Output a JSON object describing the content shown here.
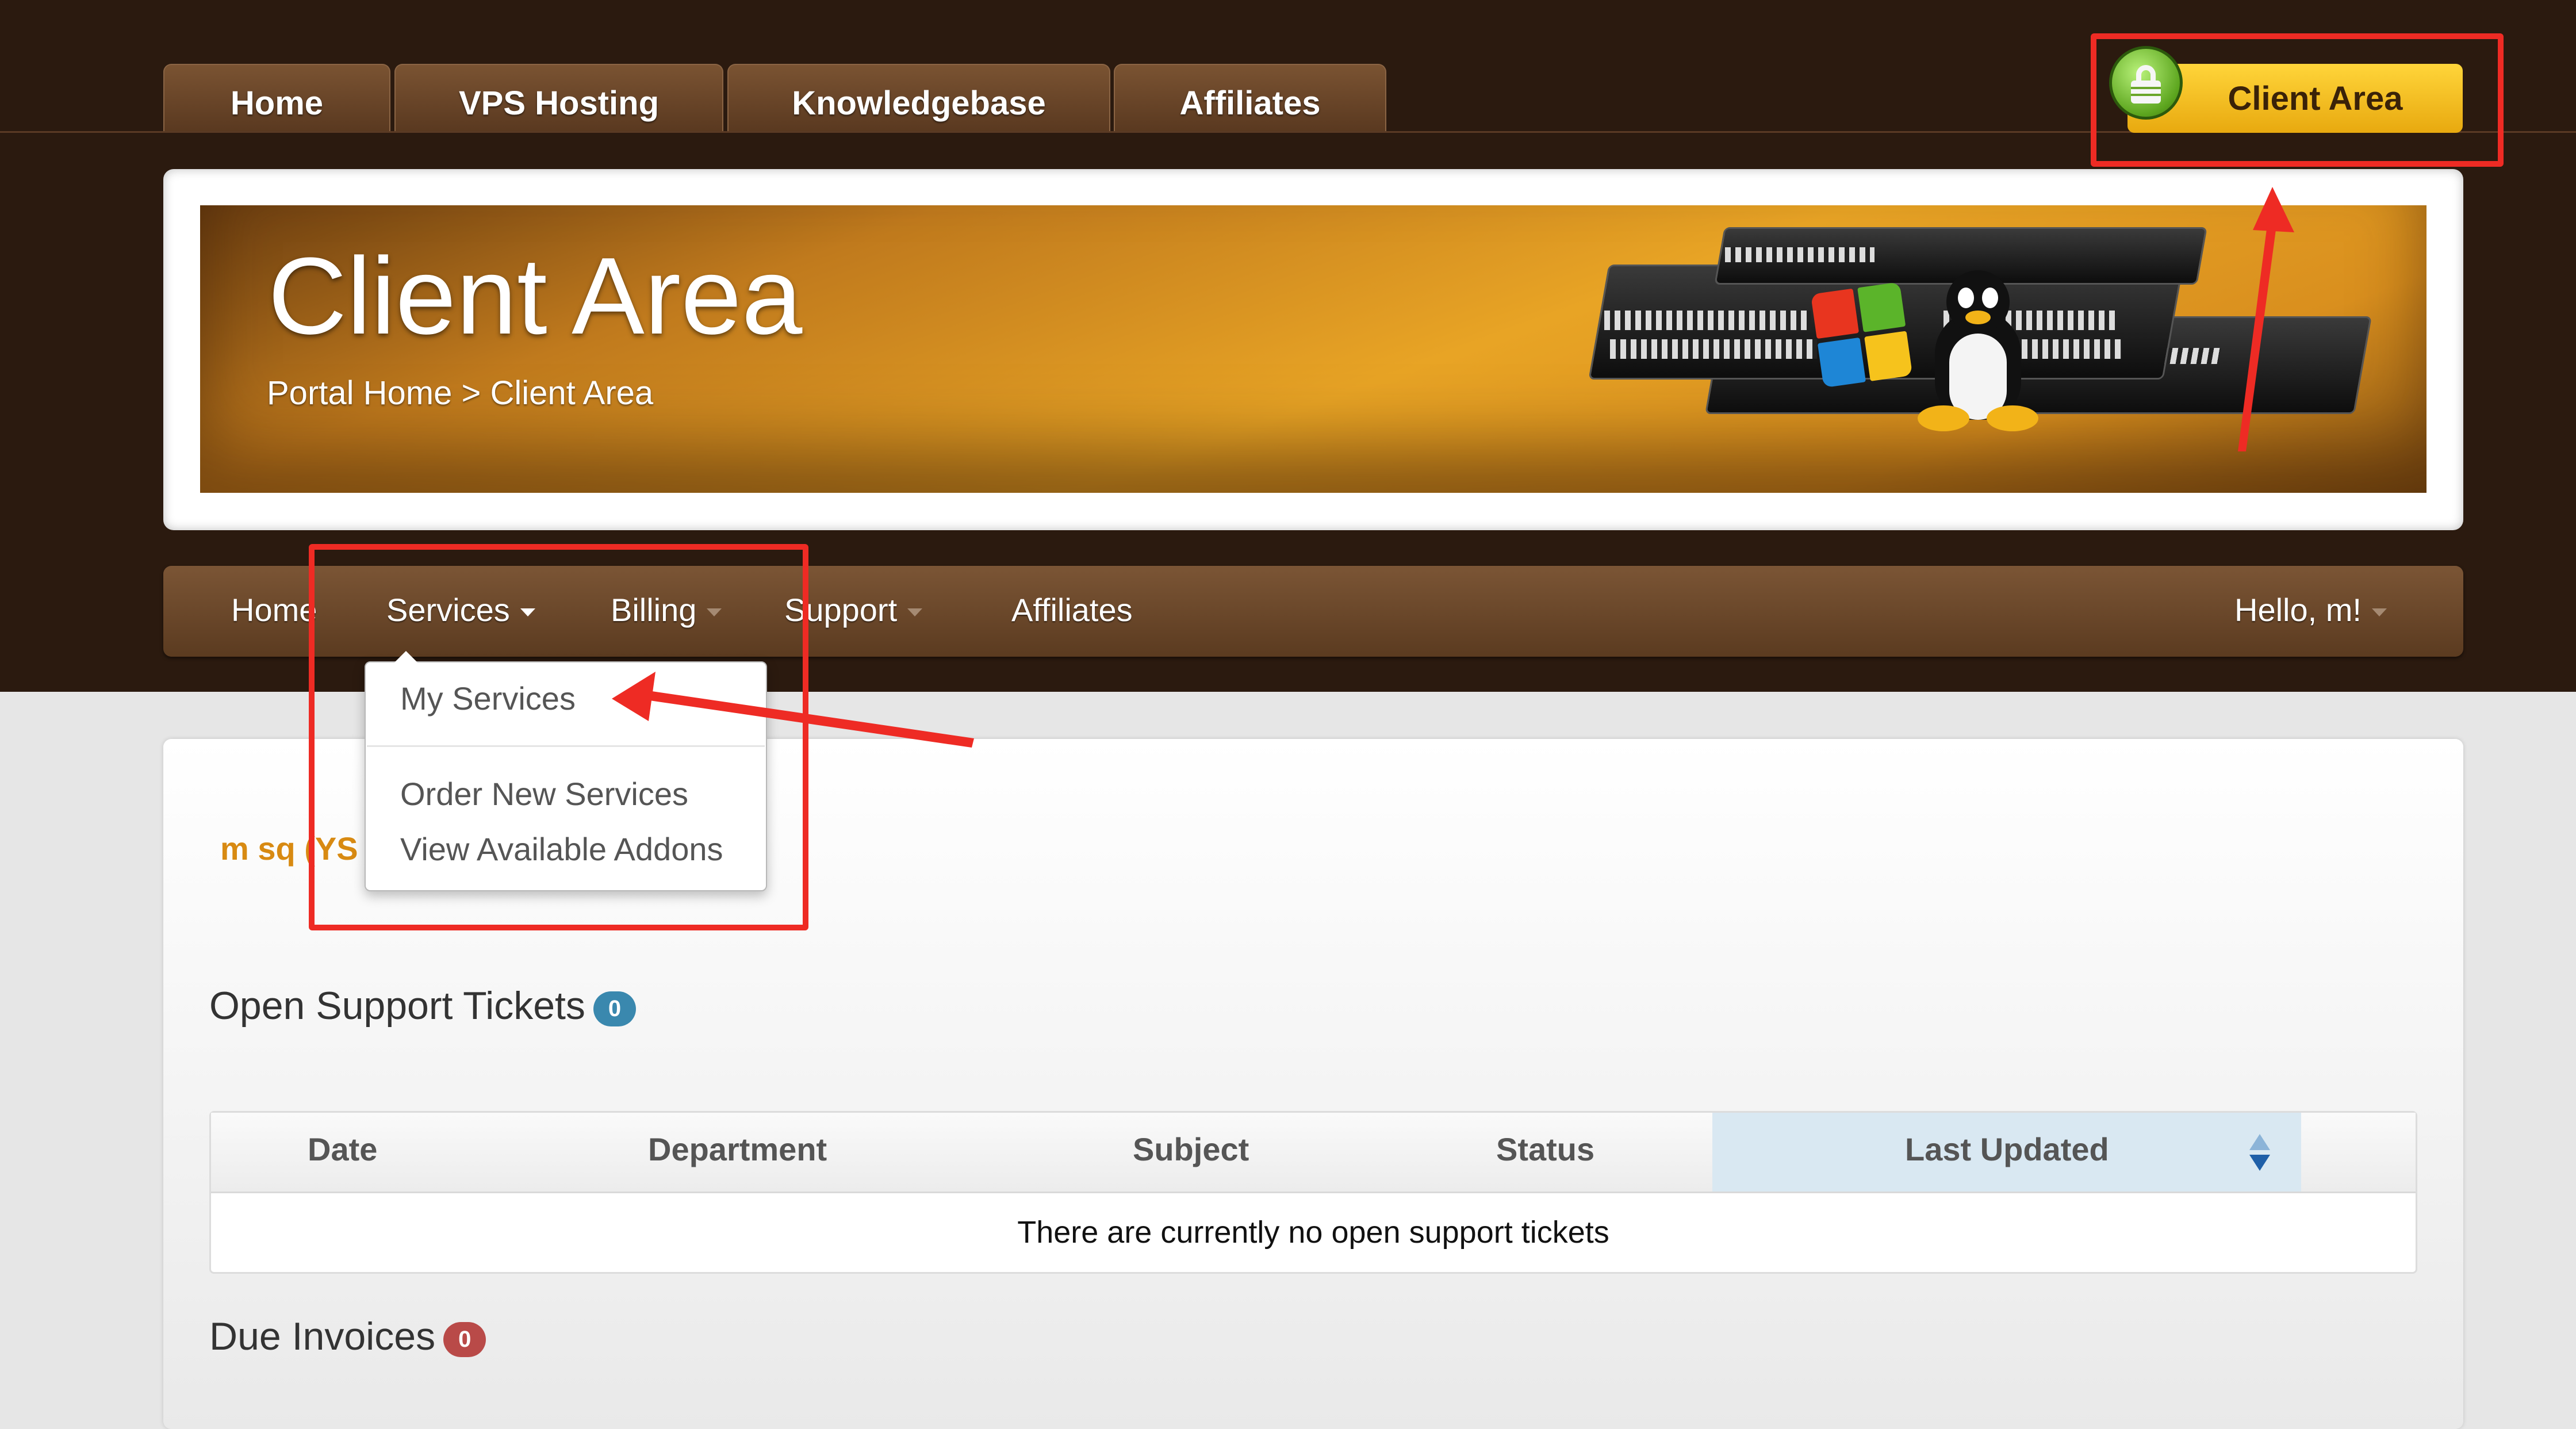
{
  "top_tabs": [
    "Home",
    "VPS Hosting",
    "Knowledgebase",
    "Affiliates"
  ],
  "client_area_button": "Client Area",
  "banner": {
    "title": "Client Area",
    "breadcrumb": "Portal Home > Client Area"
  },
  "nav": {
    "home": "Home",
    "services": "Services",
    "billing": "Billing",
    "support": "Support",
    "affiliates": "Affiliates",
    "user": "Hello, m!"
  },
  "services_dropdown": [
    "My Services",
    "Order New Services",
    "View Available Addons"
  ],
  "welcome_text": "m sq (YS",
  "support_tickets": {
    "title": "Open Support Tickets",
    "count": "0",
    "columns": [
      "Date",
      "Department",
      "Subject",
      "Status",
      "Last Updated"
    ],
    "empty_message": "There are currently no open support tickets"
  },
  "due_invoices": {
    "title": "Due Invoices",
    "count": "0"
  },
  "colors": {
    "accent": "#e8a425",
    "badge_blue": "#3a88ae",
    "badge_red": "#b94a48",
    "annotation": "#ee2b24"
  },
  "icons": [
    "lock-icon",
    "caret-down-icon",
    "sort-icon",
    "server-graphic",
    "windows-logo",
    "tux-penguin"
  ]
}
